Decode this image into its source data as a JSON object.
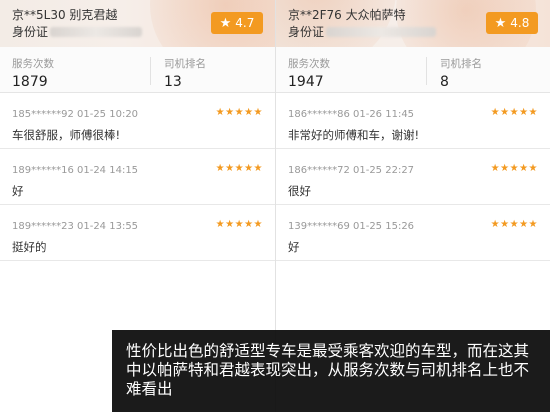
{
  "panels": [
    {
      "plate": "京**5L30 别克君越",
      "id_label": "身份证",
      "rating": "4.7",
      "stats": {
        "service_label": "服务次数",
        "service_value": "1879",
        "rank_label": "司机排名",
        "rank_value": "13"
      },
      "reviews": [
        {
          "meta": "185******92 01-25 10:20",
          "stars": "★★★★★",
          "content": "车很舒服，师傅很棒!"
        },
        {
          "meta": "189******16 01-24 14:15",
          "stars": "★★★★★",
          "content": "好"
        },
        {
          "meta": "189******23 01-24 13:55",
          "stars": "★★★★★",
          "content": "挺好的"
        }
      ]
    },
    {
      "plate": "京**2F76 大众帕萨特",
      "id_label": "身份证",
      "rating": "4.8",
      "stats": {
        "service_label": "服务次数",
        "service_value": "1947",
        "rank_label": "司机排名",
        "rank_value": "8"
      },
      "reviews": [
        {
          "meta": "186******86 01-26 11:45",
          "stars": "★★★★★",
          "content": "非常好的师傅和车，谢谢!"
        },
        {
          "meta": "186******72 01-25 22:27",
          "stars": "★★★★★",
          "content": "很好"
        },
        {
          "meta": "139******69 01-25 15:26",
          "stars": "★★★★★",
          "content": "好"
        }
      ]
    }
  ],
  "caption": "性价比出色的舒适型专车是最受乘客欢迎的车型，而在这其中以帕萨特和君越表现突出，从服务次数与司机排名上也不难看出",
  "colors": {
    "accent": "#f39a21",
    "caption_bg": "#080808"
  },
  "icons": {
    "rating": "star-icon"
  }
}
